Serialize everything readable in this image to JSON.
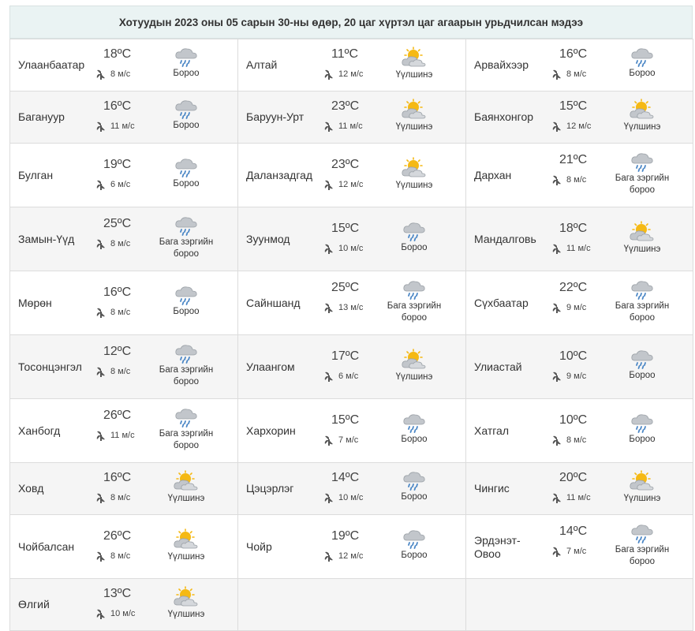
{
  "title": "Хотуудын 2023 оны 05 сарын 30-ны өдөр, 20 цаг хүртэл цаг агаарын урьдчилсан мэдээ",
  "colors": {
    "sun": "#f5b914",
    "cloud": "#c2c6cb",
    "drop": "#4a86c5",
    "header_bg": "#eaf3f3"
  },
  "rows": [
    [
      {
        "city": "Улаанбаатар",
        "temp": "18ºС",
        "wind": "8 м/с",
        "icon": "rain-cloud-icon",
        "desc": "Бороо"
      },
      {
        "city": "Алтай",
        "temp": "11ºС",
        "wind": "12 м/с",
        "icon": "sun-cloud-icon",
        "desc": "Үүлшинэ"
      },
      {
        "city": "Арвайхээр",
        "temp": "16ºС",
        "wind": "8 м/с",
        "icon": "rain-cloud-icon",
        "desc": "Бороо"
      }
    ],
    [
      {
        "city": "Багануур",
        "temp": "16ºС",
        "wind": "11 м/с",
        "icon": "rain-cloud-icon",
        "desc": "Бороо"
      },
      {
        "city": "Баруун-Урт",
        "temp": "23ºС",
        "wind": "11 м/с",
        "icon": "sun-cloud-icon",
        "desc": "Үүлшинэ"
      },
      {
        "city": "Баянхонгор",
        "temp": "15ºС",
        "wind": "12 м/с",
        "icon": "sun-cloud-icon",
        "desc": "Үүлшинэ"
      }
    ],
    [
      {
        "city": "Булган",
        "temp": "19ºС",
        "wind": "6 м/с",
        "icon": "rain-cloud-icon",
        "desc": "Бороо"
      },
      {
        "city": "Даланзадгад",
        "temp": "23ºС",
        "wind": "12 м/с",
        "icon": "sun-cloud-icon",
        "desc": "Үүлшинэ"
      },
      {
        "city": "Дархан",
        "temp": "21ºС",
        "wind": "8 м/с",
        "icon": "rain-cloud-icon",
        "desc": "Бага зэргийн бороо"
      }
    ],
    [
      {
        "city": "Замын-Үүд",
        "temp": "25ºС",
        "wind": "8 м/с",
        "icon": "rain-cloud-icon",
        "desc": "Бага зэргийн бороо"
      },
      {
        "city": "Зуунмод",
        "temp": "15ºС",
        "wind": "10 м/с",
        "icon": "rain-cloud-icon",
        "desc": "Бороо"
      },
      {
        "city": "Мандалговь",
        "temp": "18ºС",
        "wind": "11 м/с",
        "icon": "sun-cloud-icon",
        "desc": "Үүлшинэ"
      }
    ],
    [
      {
        "city": "Мөрөн",
        "temp": "16ºС",
        "wind": "8 м/с",
        "icon": "rain-cloud-icon",
        "desc": "Бороо"
      },
      {
        "city": "Сайншанд",
        "temp": "25ºС",
        "wind": "13 м/с",
        "icon": "rain-cloud-icon",
        "desc": "Бага зэргийн бороо"
      },
      {
        "city": "Сүхбаатар",
        "temp": "22ºС",
        "wind": "9 м/с",
        "icon": "rain-cloud-icon",
        "desc": "Бага зэргийн бороо"
      }
    ],
    [
      {
        "city": "Тосонцэнгэл",
        "temp": "12ºС",
        "wind": "8 м/с",
        "icon": "rain-cloud-icon",
        "desc": "Бага зэргийн бороо"
      },
      {
        "city": "Улаангом",
        "temp": "17ºС",
        "wind": "6 м/с",
        "icon": "sun-cloud-icon",
        "desc": "Үүлшинэ"
      },
      {
        "city": "Улиастай",
        "temp": "10ºС",
        "wind": "9 м/с",
        "icon": "rain-cloud-icon",
        "desc": "Бороо"
      }
    ],
    [
      {
        "city": "Ханбогд",
        "temp": "26ºС",
        "wind": "11 м/с",
        "icon": "rain-cloud-icon",
        "desc": "Бага зэргийн бороо"
      },
      {
        "city": "Хархорин",
        "temp": "15ºС",
        "wind": "7 м/с",
        "icon": "rain-cloud-icon",
        "desc": "Бороо"
      },
      {
        "city": "Хатгал",
        "temp": "10ºС",
        "wind": "8 м/с",
        "icon": "rain-cloud-icon",
        "desc": "Бороо"
      }
    ],
    [
      {
        "city": "Ховд",
        "temp": "16ºС",
        "wind": "8 м/с",
        "icon": "sun-cloud-icon",
        "desc": "Үүлшинэ"
      },
      {
        "city": "Цэцэрлэг",
        "temp": "14ºС",
        "wind": "10 м/с",
        "icon": "rain-cloud-icon",
        "desc": "Бороо"
      },
      {
        "city": "Чингис",
        "temp": "20ºС",
        "wind": "11 м/с",
        "icon": "sun-cloud-icon",
        "desc": "Үүлшинэ"
      }
    ],
    [
      {
        "city": "Чойбалсан",
        "temp": "26ºС",
        "wind": "8 м/с",
        "icon": "sun-cloud-icon",
        "desc": "Үүлшинэ"
      },
      {
        "city": "Чойр",
        "temp": "19ºС",
        "wind": "12 м/с",
        "icon": "rain-cloud-icon",
        "desc": "Бороо"
      },
      {
        "city": "Эрдэнэт-Овоо",
        "temp": "14ºС",
        "wind": "7 м/с",
        "icon": "rain-cloud-icon",
        "desc": "Бага зэргийн бороо"
      }
    ],
    [
      {
        "city": "Өлгий",
        "temp": "13ºС",
        "wind": "10 м/с",
        "icon": "sun-cloud-icon",
        "desc": "Үүлшинэ"
      },
      null,
      null
    ]
  ]
}
